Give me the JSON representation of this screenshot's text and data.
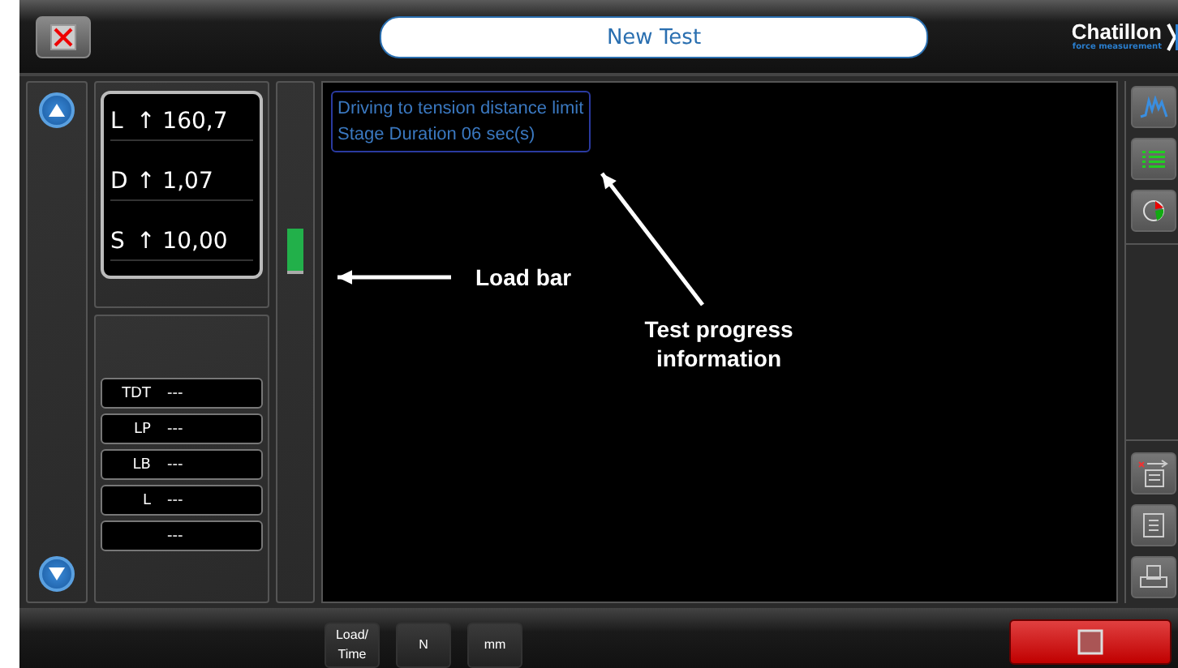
{
  "header": {
    "title": "New Test",
    "logo": {
      "name": "Chatillon",
      "tagline": "force measurement"
    }
  },
  "readings": [
    {
      "label": "L",
      "value": "↑ 160,7"
    },
    {
      "label": "D",
      "value": "↑ 1,07"
    },
    {
      "label": "S",
      "value": "↑ 10,00"
    }
  ],
  "stats": [
    {
      "label": "TDT",
      "value": "---"
    },
    {
      "label": "LP",
      "value": "---"
    },
    {
      "label": "LB",
      "value": "---"
    },
    {
      "label": "L",
      "value": "---"
    },
    {
      "value": "---"
    }
  ],
  "progress_info": [
    "Driving to tension distance limit",
    "Stage Duration 06 sec(s)"
  ],
  "annotations": [
    {
      "kind": "left",
      "text": "Load bar"
    },
    {
      "kind": "up",
      "text": "Test progress information"
    }
  ],
  "side_tools": [
    {
      "kind": "chart"
    },
    {
      "kind": "list"
    },
    {
      "kind": "pie"
    }
  ],
  "side_tools_bottom": [
    {
      "kind": "export"
    },
    {
      "kind": "report"
    },
    {
      "kind": "print"
    }
  ],
  "footer_buttons": [
    "Load/ Time",
    "N",
    "mm"
  ]
}
